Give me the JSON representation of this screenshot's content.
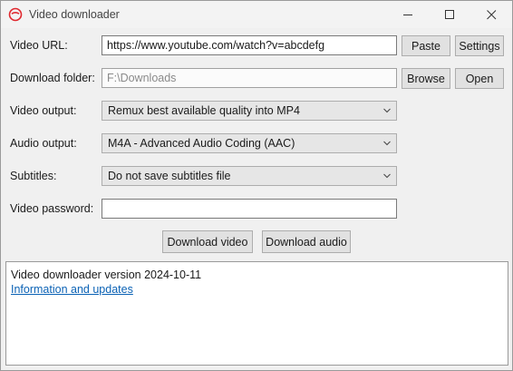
{
  "window": {
    "title": "Video downloader",
    "icon": "app-logo-icon",
    "controls": [
      "minimize-icon",
      "maximize-icon",
      "close-icon"
    ],
    "accent": "#e0282e"
  },
  "form": {
    "url_label": "Video URL:",
    "url_value": "https://www.youtube.com/watch?v=abcdefg",
    "paste_label": "Paste",
    "settings_label": "Settings",
    "folder_label": "Download folder:",
    "folder_value": "F:\\Downloads",
    "browse_label": "Browse",
    "open_label": "Open",
    "video_output_label": "Video output:",
    "video_output_value": "Remux best available quality into MP4",
    "audio_output_label": "Audio output:",
    "audio_output_value": "M4A - Advanced Audio Coding (AAC)",
    "subtitles_label": "Subtitles:",
    "subtitles_value": "Do not save subtitles file",
    "password_label": "Video password:",
    "password_value": ""
  },
  "actions": {
    "download_video": "Download video",
    "download_audio": "Download audio"
  },
  "log": {
    "version_text": "Video downloader version 2024-10-11",
    "link_text": "Information and updates",
    "link_color": "#0b62b5"
  }
}
